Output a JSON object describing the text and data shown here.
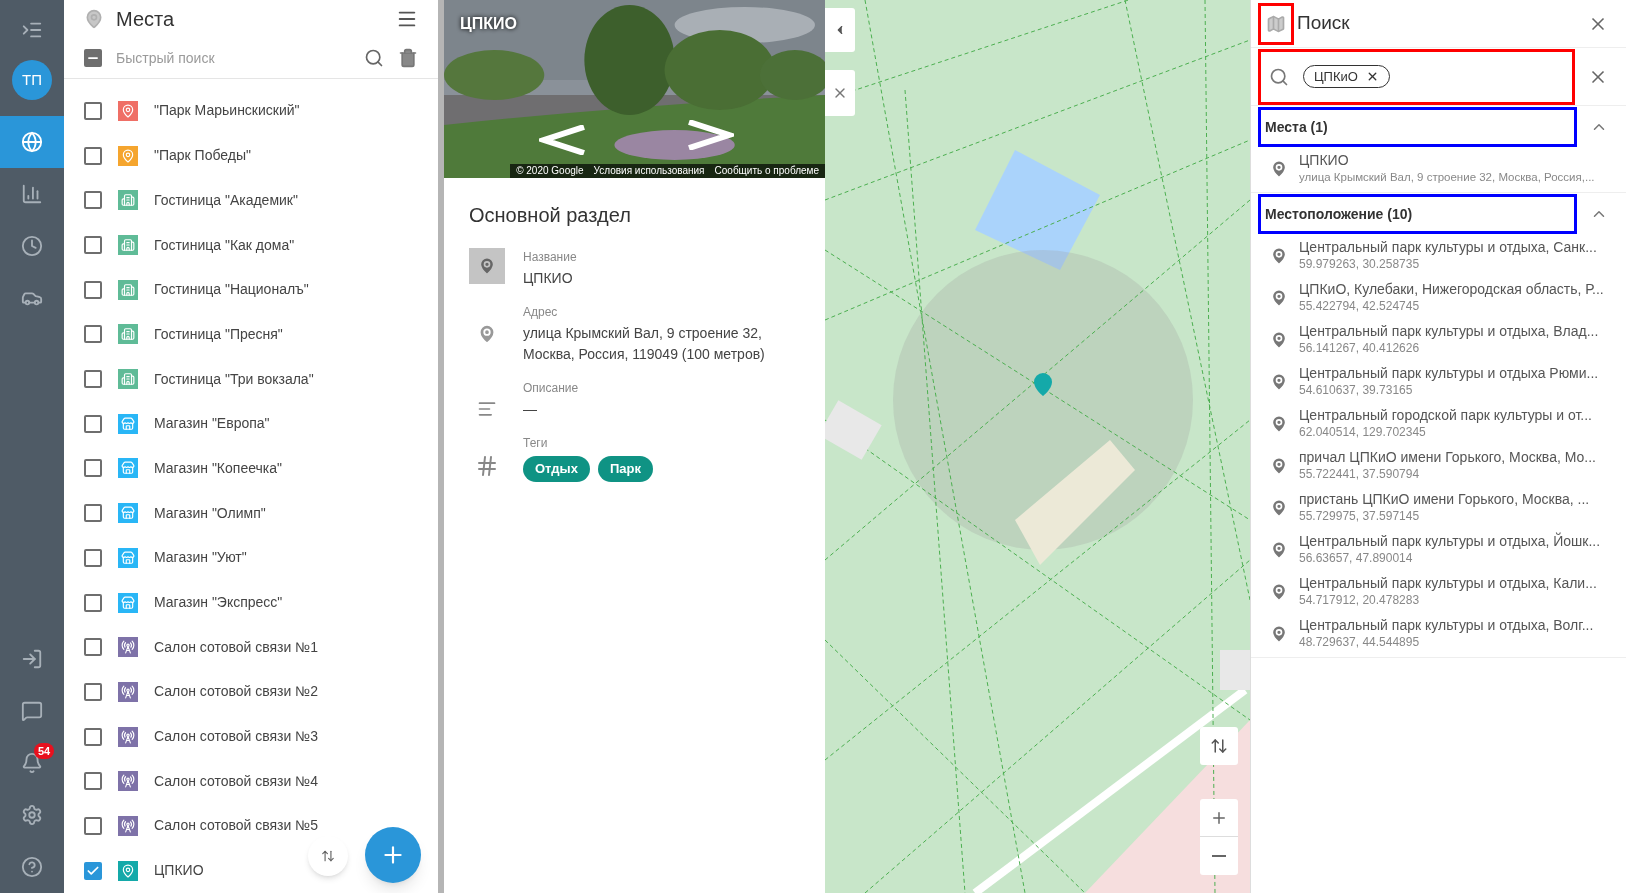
{
  "nav": {
    "avatar": "ТП",
    "top": [
      {
        "kind": "globe",
        "selected": true
      },
      {
        "kind": "chart",
        "selected": false
      },
      {
        "kind": "clock",
        "selected": false
      },
      {
        "kind": "car",
        "selected": false
      }
    ],
    "bottom": [
      {
        "kind": "login"
      },
      {
        "kind": "chat"
      },
      {
        "kind": "bell",
        "badge": "54"
      },
      {
        "kind": "settings"
      },
      {
        "kind": "help"
      }
    ]
  },
  "places_panel": {
    "title": "Места",
    "select_all_indeterminate": true,
    "search": {
      "placeholder": "Быстрый поиск"
    },
    "items": [
      {
        "name": "\"Парк Марьинскиский\"",
        "kind": "pin",
        "color": "#ef6f66",
        "checked": false
      },
      {
        "name": "\"Парк Победы\"",
        "kind": "pin",
        "color": "#f5a52e",
        "checked": false
      },
      {
        "name": "Гостиница \"Академик\"",
        "kind": "hotel",
        "color": "#5fbb97",
        "checked": false
      },
      {
        "name": "Гостиница \"Как дома\"",
        "kind": "hotel",
        "color": "#5fbb97",
        "checked": false
      },
      {
        "name": "Гостиница \"Националъ\"",
        "kind": "hotel",
        "color": "#5fbb97",
        "checked": false
      },
      {
        "name": "Гостиница \"Пресня\"",
        "kind": "hotel",
        "color": "#5fbb97",
        "checked": false
      },
      {
        "name": "Гостиница \"Три вокзала\"",
        "kind": "hotel",
        "color": "#5fbb97",
        "checked": false
      },
      {
        "name": "Магазин \"Европа\"",
        "kind": "shop",
        "color": "#29b6f6",
        "checked": false
      },
      {
        "name": "Магазин \"Копеечка\"",
        "kind": "shop",
        "color": "#29b6f6",
        "checked": false
      },
      {
        "name": "Магазин \"Олимп\"",
        "kind": "shop",
        "color": "#29b6f6",
        "checked": false
      },
      {
        "name": "Магазин \"Уют\"",
        "kind": "shop",
        "color": "#29b6f6",
        "checked": false
      },
      {
        "name": "Магазин \"Экспресс\"",
        "kind": "shop",
        "color": "#29b6f6",
        "checked": false
      },
      {
        "name": "Салон сотовой связи №1",
        "kind": "tower",
        "color": "#7e72a8",
        "checked": false
      },
      {
        "name": "Салон сотовой связи №2",
        "kind": "tower",
        "color": "#7e72a8",
        "checked": false
      },
      {
        "name": "Салон сотовой связи №3",
        "kind": "tower",
        "color": "#7e72a8",
        "checked": false
      },
      {
        "name": "Салон сотовой связи №4",
        "kind": "tower",
        "color": "#7e72a8",
        "checked": false
      },
      {
        "name": "Салон сотовой связи №5",
        "kind": "tower",
        "color": "#7e72a8",
        "checked": false
      },
      {
        "name": "ЦПКИО",
        "kind": "pin",
        "color": "#14a9a9",
        "checked": true
      }
    ]
  },
  "details": {
    "photo": {
      "kind": "picture",
      "title": "ЦПКИО",
      "attribution": [
        "© 2020 Google",
        "Условия использования",
        "Сообщить о проблеме"
      ]
    },
    "section": "Основной раздел",
    "fields": [
      {
        "kind": "name",
        "label": "Название",
        "value": "ЦПКИО"
      },
      {
        "kind": "address",
        "label": "Адрес",
        "value": "улица Крымский Вал, 9 строение 32, Москва, Россия, 119049 (100 метров)"
      },
      {
        "kind": "description",
        "label": "Описание",
        "value": "—"
      },
      {
        "kind": "tags",
        "label": "Теги",
        "tags": [
          "Отдых",
          "Парк"
        ]
      }
    ]
  },
  "search_panel": {
    "title": "Поиск",
    "title_icon": {
      "color": "#ff0000"
    },
    "field": {
      "color": "#ff0000"
    },
    "chips": [
      "ЦПКиО"
    ],
    "groups": [
      {
        "title": "Места (1)",
        "color": "#0000ff",
        "expanded": true,
        "items": [
          {
            "kind": "place",
            "name": "ЦПКИО",
            "detail": "улица Крымский Вал, 9 строение 32, Москва, Россия,..."
          }
        ]
      },
      {
        "title": "Местоположение (10)",
        "color": "#0000ff",
        "expanded": true,
        "items": [
          {
            "kind": "location",
            "name": "Центральный парк культуры и отдыха, Санк...",
            "detail": "59.979263, 30.258735"
          },
          {
            "kind": "location",
            "name": "ЦПКиО, Кулебаки, Нижегородская область, Р...",
            "detail": "55.422794, 42.524745"
          },
          {
            "kind": "location",
            "name": "Центральный парк культуры и отдыха, Влад...",
            "detail": "56.141267, 40.412626"
          },
          {
            "kind": "location",
            "name": "Центральный парк культуры и отдыха Рюми...",
            "detail": "54.610637, 39.73165"
          },
          {
            "kind": "location",
            "name": "Центральный городской парк культуры и от...",
            "detail": "62.040514, 129.702345"
          },
          {
            "kind": "location",
            "name": "причал ЦПКиО имени Горького, Москва, Мо...",
            "detail": "55.722441, 37.590794"
          },
          {
            "kind": "location",
            "name": "пристань ЦПКиО имени Горького, Москва, ...",
            "detail": "55.729975, 37.597145"
          },
          {
            "kind": "location",
            "name": "Центральный парк культуры и отдыха, Йошк...",
            "detail": "56.63657, 47.890014"
          },
          {
            "kind": "location",
            "name": "Центральный парк культуры и отдыха, Кали...",
            "detail": "54.717912, 20.478283"
          },
          {
            "kind": "location",
            "name": "Центральный парк культуры и отдыха, Волг...",
            "detail": "48.729637, 44.544895"
          }
        ]
      }
    ]
  }
}
